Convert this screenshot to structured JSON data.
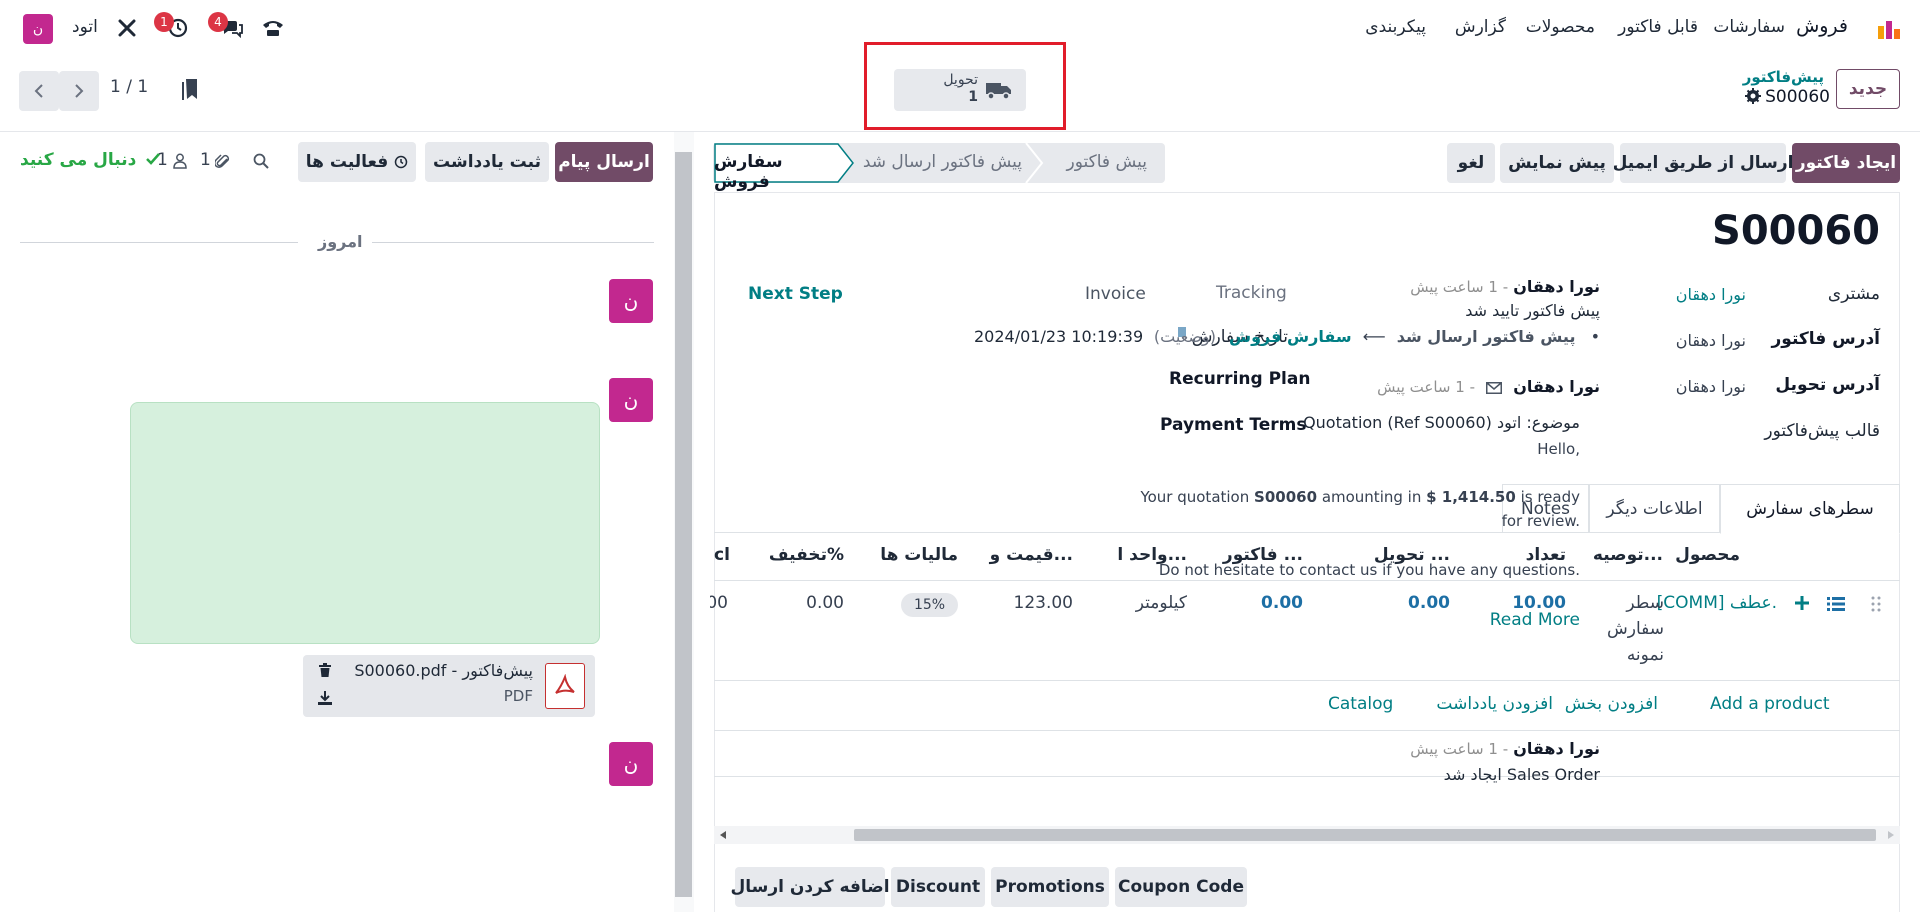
{
  "topnav": {
    "brand": "فروش",
    "menu": [
      "سفارشات",
      "قابل فاکتور",
      "محصولات",
      "گزارش",
      "پیکربندی"
    ],
    "company": "اتود",
    "avatar_letter": "ن",
    "messages_badge": "4",
    "activities_badge": "1"
  },
  "controlpanel": {
    "new_button": "جدید",
    "breadcrumb_parent": "پیش‌فاکتور",
    "record_name": "S00060",
    "smart_button_label": "تحویل",
    "smart_button_count": "1",
    "pager": "1 / 1"
  },
  "actions": {
    "create_invoice": "ایجاد فاکتور",
    "send_email": "ارسال از طریق ایمیل",
    "preview": "پیش نمایش",
    "cancel": "لغو"
  },
  "statusbar": [
    "پیش فاکتور",
    "پیش فاکتور ارسال شد",
    "سفارش فروش"
  ],
  "form": {
    "title": "S00060",
    "customer_label": "مشتری",
    "customer_value": "نورا دهقان",
    "invoice_address_label": "آدرس فاکتور",
    "invoice_address_value": "نورا دهقان",
    "delivery_address_label": "آدرس تحویل",
    "delivery_address_value": "نورا دهقان",
    "template_label": "قالب پیش‌فاکتور",
    "tracking_label": "Tracking",
    "invoice_label": "Invoice",
    "next_step_label": "Next Step",
    "order_date_label": "تاریخ سفارش",
    "order_date_value": "2024/01/23 10:19:39",
    "recurring_plan_label": "Recurring Plan",
    "payment_terms_label": "Payment Terms"
  },
  "tabs": [
    "سطرهای سفارش",
    "اطلاعات دیگر",
    "Notes"
  ],
  "order_lines": {
    "columns": [
      "محصول",
      "توصیه...",
      "تعداد",
      "تحویل ...",
      "فاکتور ...",
      "واحد ا...",
      "قیمت و...",
      "مالیات ها",
      "تخفیف%",
      "cl"
    ],
    "rows": [
      {
        "product": "[COMM] عطف.",
        "description_1": "سطر",
        "description_2": "سفارش",
        "description_3": "نمونه",
        "quantity": "10.00",
        "delivered": "0.00",
        "invoiced": "0.00",
        "uom": "کیلومتر",
        "price": "123.00",
        "tax": "15%",
        "discount": "0.00",
        "subtotal_partial": "00"
      }
    ],
    "add_product": "Add a product",
    "add_section": "افزودن بخش",
    "add_note": "افزودن یادداشت",
    "catalog": "Catalog"
  },
  "footer_buttons": [
    "Coupon Code",
    "Promotions",
    "Discount",
    "اضافه کردن ارسال"
  ],
  "chatter": {
    "send_message": "ارسال پیام",
    "log_note": "ثبت یادداشت",
    "activities": "فعالیت ها",
    "attachments_count": "1",
    "followers_count": "1",
    "following": "دنبال می کنید",
    "today": "امروز",
    "messages": [
      {
        "author": "نورا دهقان",
        "time": "- 1 ساعت پیش",
        "body": "پیش فاکتور تایید شد",
        "change_from": "پیش فاکتور ارسال شد",
        "change_to": "سفارش فروش",
        "change_field": "(وضعیت)"
      },
      {
        "author": "نورا دهقان",
        "time": "- 1 ساعت پیش",
        "subject": "موضوع: اتود Quotation (Ref S00060)",
        "hello": "Hello,",
        "line1_a": "Your quotation",
        "line1_ref": "S00060",
        "line1_b": "amounting in",
        "line1_amount": "$ 1,414.50",
        "line1_c": "is ready",
        "line2": "for review.",
        "line3": "Do not hesitate to contact us if you have any questions.",
        "read_more": "Read More",
        "attachment_name": "پیش‌فاکتور - S00060.pdf",
        "attachment_type": "PDF"
      },
      {
        "author": "نورا دهقان",
        "time": "- 1 ساعت پیش",
        "body": "Sales Order ایجاد شد"
      }
    ]
  },
  "colors": {
    "primary": "#714b67",
    "link": "#017e84",
    "avatar": "#c2288f",
    "highlight_box": "#e11d2a"
  }
}
